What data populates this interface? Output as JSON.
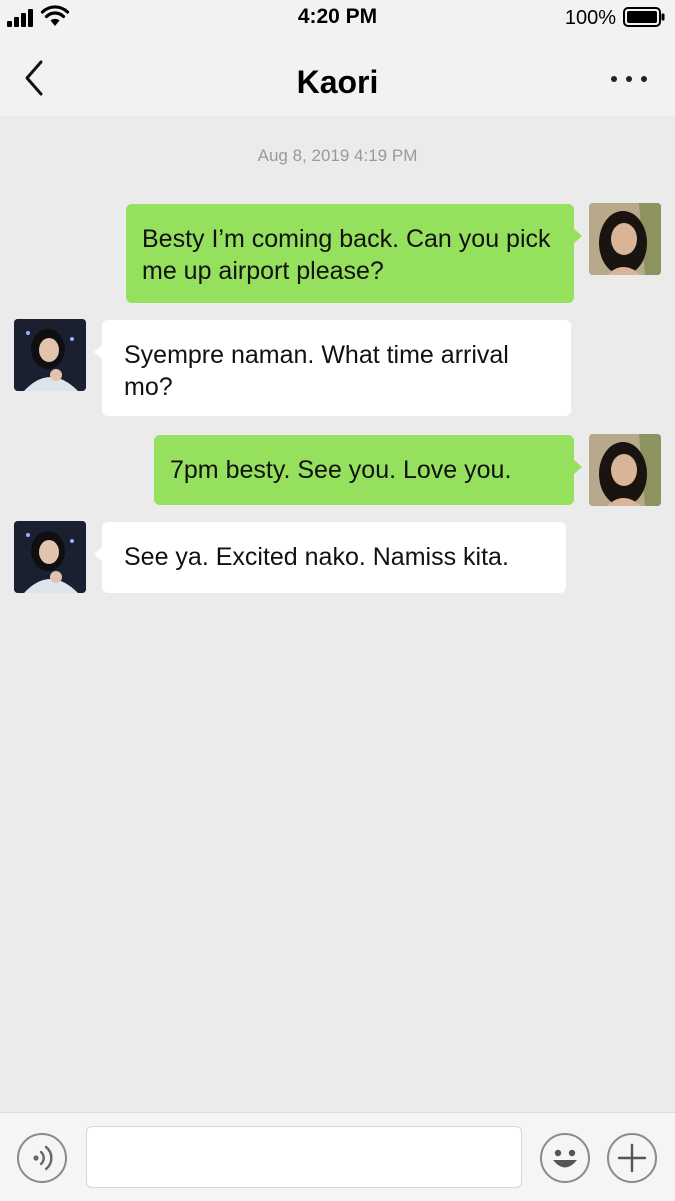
{
  "status_bar": {
    "time": "4:20 PM",
    "battery_percent": "100%",
    "battery_level": 1.0,
    "signal_icon": "cellular-signal-icon",
    "wifi_icon": "wifi-icon"
  },
  "nav": {
    "title": "Kaori",
    "back_icon": "chevron-left-icon",
    "more_icon": "more-dots-icon"
  },
  "chat": {
    "timestamp": "Aug 8, 2019 4:19 PM",
    "messages": [
      {
        "direction": "outgoing",
        "text": "Besty I’m coming back. Can you pick me up airport please?"
      },
      {
        "direction": "incoming",
        "text": "Syempre naman. What time arrival mo?"
      },
      {
        "direction": "outgoing",
        "text": "7pm besty. See you. Love you."
      },
      {
        "direction": "incoming",
        "text": "See ya. Excited nako. Namiss kita."
      }
    ]
  },
  "input_bar": {
    "input_value": "",
    "voice_icon": "voice-icon",
    "emoji_icon": "emoji-icon",
    "plus_icon": "plus-icon"
  },
  "colors": {
    "outgoing_bubble": "#95e05c",
    "incoming_bubble": "#ffffff",
    "background": "#ebebeb"
  }
}
